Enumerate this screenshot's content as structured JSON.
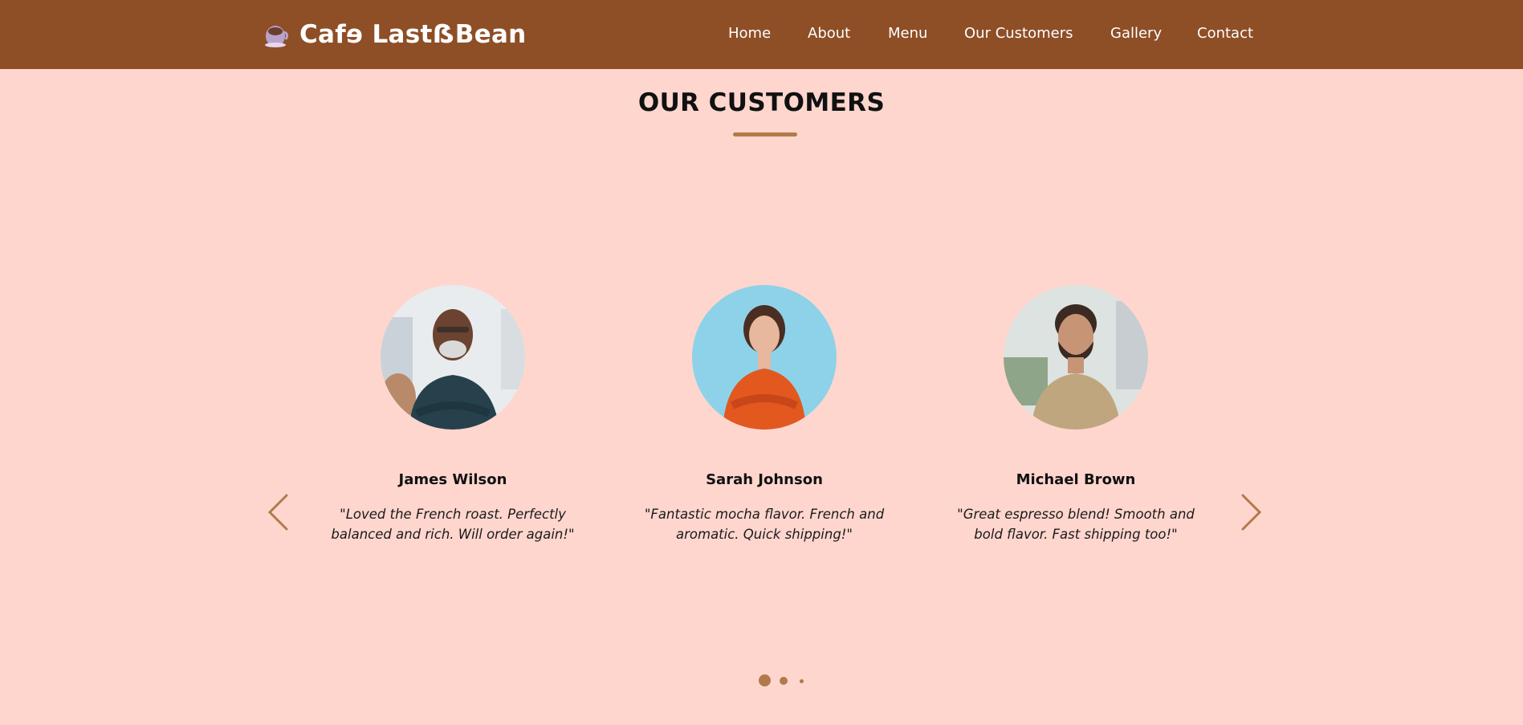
{
  "brand": {
    "name": "Cafɘ LastẞBean"
  },
  "nav": {
    "items": [
      {
        "label": "Home"
      },
      {
        "label": "About"
      },
      {
        "label": "Menu"
      },
      {
        "label": "Our Customers"
      },
      {
        "label": "Gallery"
      },
      {
        "label": "Contact"
      }
    ]
  },
  "section": {
    "title": "OUR CUSTOMERS"
  },
  "customers": [
    {
      "name": "James Wilson",
      "quote": "\"Loved the French roast. Perfectly balanced and rich. Will order again!\""
    },
    {
      "name": "Sarah Johnson",
      "quote": "\"Fantastic mocha flavor. French and aromatic. Quick shipping!\""
    },
    {
      "name": "Michael Brown",
      "quote": "\"Great espresso blend! Smooth and bold flavor. Fast shipping too!\""
    }
  ],
  "carousel": {
    "pages": 3,
    "active_page": 1
  },
  "colors": {
    "header": "#8E4E26",
    "background": "#FFD6CE",
    "accent": "#B27A4B"
  },
  "icons": {
    "logo": "coffee-cup-icon",
    "prev": "chevron-left-icon",
    "next": "chevron-right-icon"
  }
}
